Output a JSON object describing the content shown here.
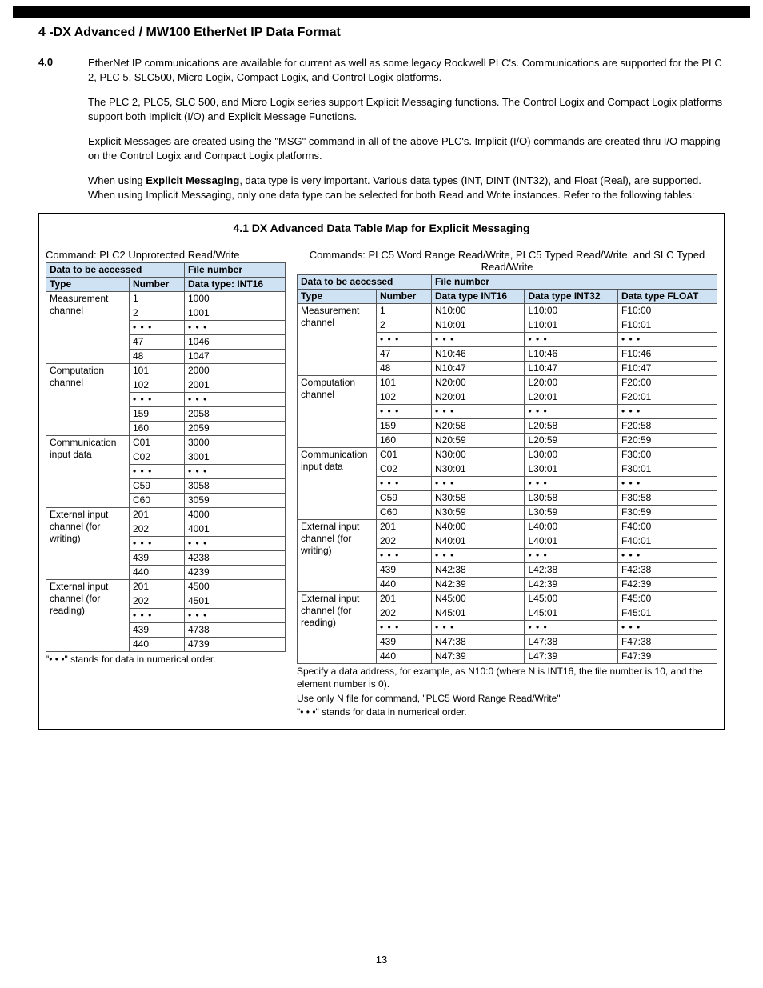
{
  "heading": "4 -DX Advanced / MW100 EtherNet IP Data Format",
  "para_num": "4.0",
  "para1": "EtherNet IP communications are available for current as well as some legacy Rockwell PLC's. Communications are supported for the PLC 2, PLC 5, SLC500, Micro Logix, Compact Logix, and Control Logix platforms.",
  "para2": "The PLC 2, PLC5, SLC 500, and Micro Logix series support Explicit Messaging functions. The Control Logix and Compact Logix platforms support both Implicit (I/O) and Explicit Message Functions.",
  "para3": "Explicit Messages are created using the \"MSG\" command in all of the above PLC's. Implicit (I/O) commands are created thru I/O mapping on the Control Logix and Compact Logix platforms.",
  "para4_a": "When using ",
  "para4_bold": "Explicit Messaging",
  "para4_b": ", data type is very important. Various data types (INT, DINT (INT32), and Float (Real), are supported. When using Implicit Messaging, only one data type can be selected for both Read and Write instances. Refer to the following tables:",
  "box_title": "4.1 DX Advanced Data Table Map for Explicit Messaging",
  "left": {
    "caption": "Command: PLC2 Unprotected Read/Write",
    "h_access": "Data to be accessed",
    "h_file": "File number",
    "h_type": "Type",
    "h_number": "Number",
    "h_datatype": "Data type: INT16",
    "groups": [
      {
        "type": "Measurement channel",
        "rows": [
          {
            "n": "1",
            "f": "1000"
          },
          {
            "n": "2",
            "f": "1001"
          },
          {
            "n": "• • •",
            "f": "• • •"
          },
          {
            "n": "47",
            "f": "1046"
          },
          {
            "n": "48",
            "f": "1047"
          }
        ]
      },
      {
        "type": "Computation channel",
        "rows": [
          {
            "n": "101",
            "f": "2000"
          },
          {
            "n": "102",
            "f": "2001"
          },
          {
            "n": "• • •",
            "f": "• • •"
          },
          {
            "n": "159",
            "f": "2058"
          },
          {
            "n": "160",
            "f": "2059"
          }
        ]
      },
      {
        "type": "Communication input data",
        "rows": [
          {
            "n": "C01",
            "f": "3000"
          },
          {
            "n": "C02",
            "f": "3001"
          },
          {
            "n": "• • •",
            "f": "• • •"
          },
          {
            "n": "C59",
            "f": "3058"
          },
          {
            "n": "C60",
            "f": "3059"
          }
        ]
      },
      {
        "type": "External input channel (for writing)",
        "rows": [
          {
            "n": "201",
            "f": "4000"
          },
          {
            "n": "202",
            "f": "4001"
          },
          {
            "n": "• • •",
            "f": "• • •"
          },
          {
            "n": "439",
            "f": "4238"
          },
          {
            "n": "440",
            "f": "4239"
          }
        ]
      },
      {
        "type": "External input channel (for reading)",
        "rows": [
          {
            "n": "201",
            "f": "4500"
          },
          {
            "n": "202",
            "f": "4501"
          },
          {
            "n": "• • •",
            "f": "• • •"
          },
          {
            "n": "439",
            "f": "4738"
          },
          {
            "n": "440",
            "f": "4739"
          }
        ]
      }
    ],
    "footnote": "\"• • •\" stands for data in numerical order."
  },
  "right": {
    "caption": "Commands: PLC5 Word Range Read/Write, PLC5 Typed Read/Write, and SLC Typed Read/Write",
    "h_access": "Data to be accessed",
    "h_file": "File number",
    "h_type": "Type",
    "h_number": "Number",
    "h_int16": "Data type INT16",
    "h_int32": "Data type INT32",
    "h_float": "Data type FLOAT",
    "groups": [
      {
        "type": "Measurement channel",
        "rows": [
          {
            "n": "1",
            "a": "N10:00",
            "b": "L10:00",
            "c": "F10:00"
          },
          {
            "n": "2",
            "a": "N10:01",
            "b": "L10:01",
            "c": "F10:01"
          },
          {
            "n": "• • •",
            "a": "• • •",
            "b": "• • •",
            "c": "• • •"
          },
          {
            "n": "47",
            "a": "N10:46",
            "b": "L10:46",
            "c": "F10:46"
          },
          {
            "n": "48",
            "a": "N10:47",
            "b": "L10:47",
            "c": "F10:47"
          }
        ]
      },
      {
        "type": "Computation channel",
        "rows": [
          {
            "n": "101",
            "a": "N20:00",
            "b": "L20:00",
            "c": "F20:00"
          },
          {
            "n": "102",
            "a": "N20:01",
            "b": "L20:01",
            "c": "F20:01"
          },
          {
            "n": "• • •",
            "a": "• • •",
            "b": "• • •",
            "c": "• • •"
          },
          {
            "n": "159",
            "a": "N20:58",
            "b": "L20:58",
            "c": "F20:58"
          },
          {
            "n": "160",
            "a": "N20:59",
            "b": "L20:59",
            "c": "F20:59"
          }
        ]
      },
      {
        "type": "Communication input data",
        "rows": [
          {
            "n": "C01",
            "a": "N30:00",
            "b": "L30:00",
            "c": "F30:00"
          },
          {
            "n": "C02",
            "a": "N30:01",
            "b": "L30:01",
            "c": "F30:01"
          },
          {
            "n": "• • •",
            "a": "• • •",
            "b": "• • •",
            "c": "• • •"
          },
          {
            "n": "C59",
            "a": "N30:58",
            "b": "L30:58",
            "c": "F30:58"
          },
          {
            "n": "C60",
            "a": "N30:59",
            "b": "L30:59",
            "c": "F30:59"
          }
        ]
      },
      {
        "type": "External input channel (for writing)",
        "rows": [
          {
            "n": "201",
            "a": "N40:00",
            "b": "L40:00",
            "c": "F40:00"
          },
          {
            "n": "202",
            "a": "N40:01",
            "b": "L40:01",
            "c": "F40:01"
          },
          {
            "n": "• • •",
            "a": "• • •",
            "b": "• • •",
            "c": "• • •"
          },
          {
            "n": "439",
            "a": "N42:38",
            "b": "L42:38",
            "c": "F42:38"
          },
          {
            "n": "440",
            "a": "N42:39",
            "b": "L42:39",
            "c": "F42:39"
          }
        ]
      },
      {
        "type": "External input channel (for reading)",
        "rows": [
          {
            "n": "201",
            "a": "N45:00",
            "b": "L45:00",
            "c": "F45:00"
          },
          {
            "n": "202",
            "a": "N45:01",
            "b": "L45:01",
            "c": "F45:01"
          },
          {
            "n": "• • •",
            "a": "• • •",
            "b": "• • •",
            "c": "• • •"
          },
          {
            "n": "439",
            "a": "N47:38",
            "b": "L47:38",
            "c": "F47:38"
          },
          {
            "n": "440",
            "a": "N47:39",
            "b": "L47:39",
            "c": "F47:39"
          }
        ]
      }
    ],
    "foot1": "Specify a data address, for example, as N10:0 (where N is INT16, the file number is 10, and the element number is 0).",
    "foot2": "Use only N file for command, \"PLC5 Word Range Read/Write\"",
    "foot3": "\"• • •\" stands for data in numerical order."
  },
  "page_number": "13"
}
